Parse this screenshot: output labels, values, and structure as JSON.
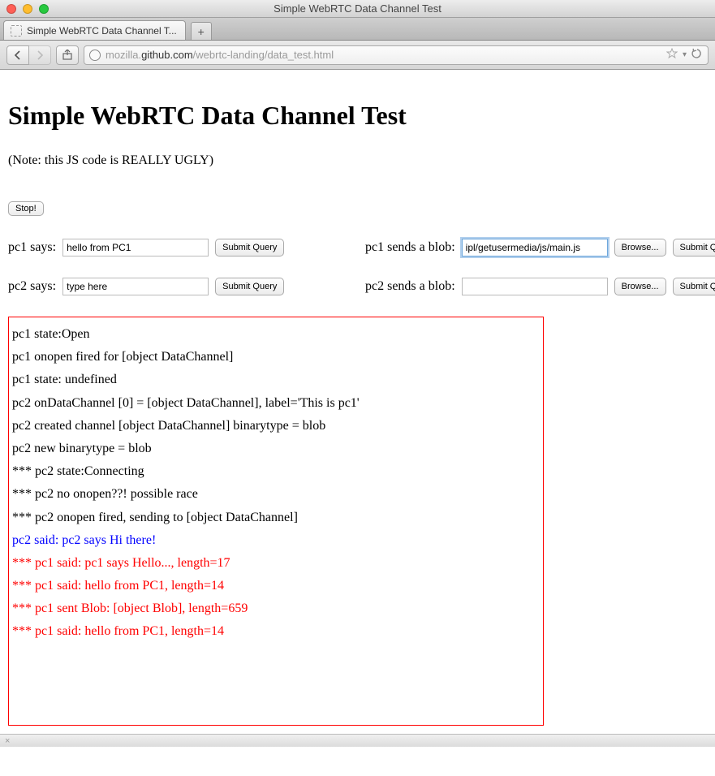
{
  "window": {
    "title": "Simple WebRTC Data Channel Test"
  },
  "tab": {
    "title": "Simple WebRTC Data Channel T..."
  },
  "url": {
    "host_prefix": "mozilla.",
    "host_main": "github.com",
    "path": "/webrtc-landing/data_test.html"
  },
  "page": {
    "heading": "Simple WebRTC Data Channel Test",
    "note": "(Note: this JS code is REALLY UGLY)",
    "stop_label": "Stop!",
    "pc1_says_label": "pc1 says:",
    "pc1_says_value": "hello from PC1",
    "pc2_says_label": "pc2 says:",
    "pc2_says_value": "type here",
    "pc1_blob_label": "pc1 sends a blob:",
    "pc1_blob_value": "ipl/getusermedia/js/main.js",
    "pc2_blob_label": "pc2 sends a blob:",
    "pc2_blob_value": "",
    "browse_label": "Browse...",
    "submit_label": "Submit Query"
  },
  "log": [
    {
      "text": "pc1 state:Open",
      "cls": ""
    },
    {
      "text": "pc1 onopen fired for [object DataChannel]",
      "cls": ""
    },
    {
      "text": "pc1 state: undefined",
      "cls": ""
    },
    {
      "text": "pc2 onDataChannel [0] = [object DataChannel], label='This is pc1'",
      "cls": ""
    },
    {
      "text": "pc2 created channel [object DataChannel] binarytype = blob",
      "cls": ""
    },
    {
      "text": "pc2 new binarytype = blob",
      "cls": ""
    },
    {
      "text": "*** pc2 state:Connecting",
      "cls": ""
    },
    {
      "text": "*** pc2 no onopen??! possible race",
      "cls": ""
    },
    {
      "text": "*** pc2 onopen fired, sending to [object DataChannel]",
      "cls": ""
    },
    {
      "text": "pc2 said: pc2 says Hi there!",
      "cls": "blue"
    },
    {
      "text": "*** pc1 said: pc1 says Hello..., length=17",
      "cls": "red"
    },
    {
      "text": "*** pc1 said: hello from PC1, length=14",
      "cls": "red"
    },
    {
      "text": "*** pc1 sent Blob: [object Blob], length=659",
      "cls": "red"
    },
    {
      "text": "*** pc1 said: hello from PC1, length=14",
      "cls": "red"
    }
  ],
  "statusbar": {
    "text": "×"
  }
}
